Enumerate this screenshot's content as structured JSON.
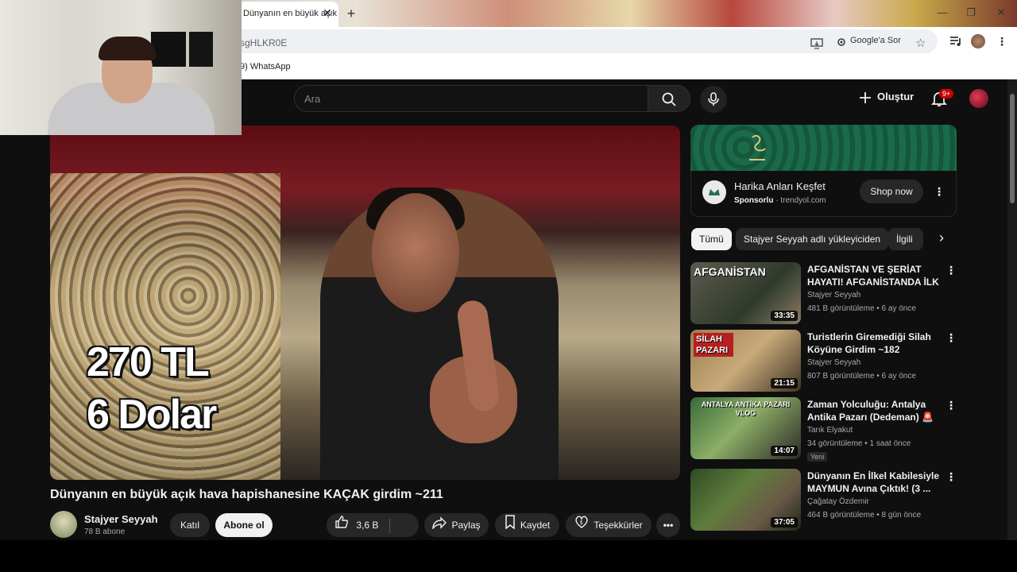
{
  "browser": {
    "tab_title": "Dünyanın en büyük açık",
    "url_fragment": "sgHLKR0E",
    "lens_label": "Google'a Sor",
    "bookmark": "9) WhatsApp"
  },
  "header": {
    "search_placeholder": "Ara",
    "create_label": "Oluştur",
    "notifications_badge": "9+"
  },
  "video": {
    "overlay_line1": "270 TL",
    "overlay_line2": "6 Dolar",
    "title": "Dünyanın en büyük açık hava hapishanesine KAÇAK girdim ~211",
    "channel": "Stajyer Seyyah",
    "subscribers": "78 B abone",
    "join_label": "Katıl",
    "subscribe_label": "Abone ol",
    "likes": "3,6 B",
    "share_label": "Paylaş",
    "save_label": "Kaydet",
    "thanks_label": "Teşekkürler"
  },
  "ad": {
    "title": "Harika Anları Keşfet",
    "sponsored": "Sponsorlu",
    "domain": "trendyol.com",
    "cta": "Shop now"
  },
  "chips": [
    "Tümü",
    "Stajyer Seyyah adlı yükleyiciden",
    "İlgili"
  ],
  "recommendations": [
    {
      "thumb_text": "AFGANİSTAN",
      "title": "AFGANİSTAN VE ŞERİAT HAYATI! AFGANİSTANDA İLK ...",
      "channel": "Stajyer Seyyah",
      "meta": "481 B görüntüleme • 6 ay önce",
      "duration": "33:35",
      "badge": ""
    },
    {
      "thumb_text": "SİLAH PAZARI",
      "title": "Turistlerin Giremediği Silah Köyüne Girdim ~182",
      "channel": "Stajyer Seyyah",
      "meta": "807 B görüntüleme • 6 ay önce",
      "duration": "21:15",
      "badge": ""
    },
    {
      "thumb_text": "ANTALYA ANTİKA PAZARI VLOG",
      "title": "Zaman Yolculuğu: Antalya Antika Pazarı (Dedeman) 🚨",
      "channel": "Tarık Elyakut",
      "meta": "34 görüntüleme • 1 saat önce",
      "duration": "14:07",
      "badge": "Yeni"
    },
    {
      "thumb_text": "",
      "title": "Dünyanın En İlkel Kabilesiyle MAYMUN Avına Çıktık! (3 ...",
      "channel": "Çağatay Özdemir",
      "meta": "464 B görüntüleme • 8 gün önce",
      "duration": "37:05",
      "badge": ""
    }
  ],
  "colors": {
    "background": "#0f0f0f",
    "text_primary": "#f1f1f1",
    "text_secondary": "#aaaaaa",
    "chip_bg": "#272727",
    "badge_red": "#cc0000"
  }
}
